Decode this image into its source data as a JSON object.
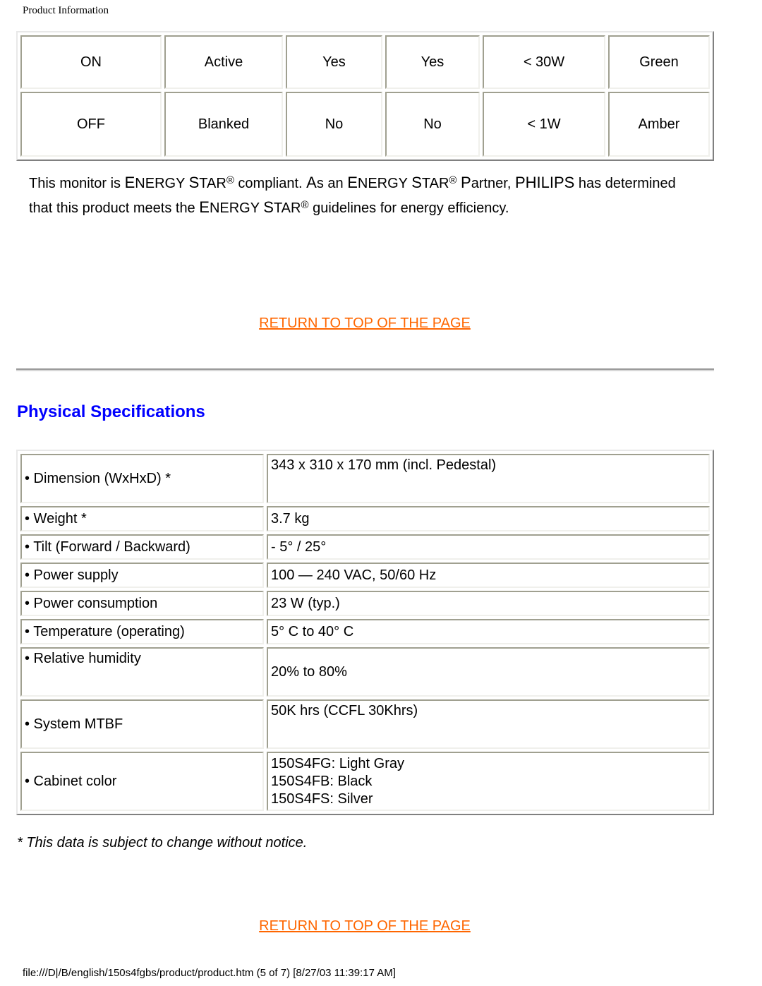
{
  "header": {
    "title": "Product Information"
  },
  "power_table": {
    "rows": [
      [
        "ON",
        "Active",
        "Yes",
        "Yes",
        "< 30W",
        "Green"
      ],
      [
        "OFF",
        "Blanked",
        "No",
        "No",
        "< 1W",
        "Amber"
      ]
    ]
  },
  "energy_star": {
    "p1_a": "This monitor is ",
    "brand_cap_e": "E",
    "brand_rest_1": "NERGY ",
    "brand_cap_s": "S",
    "brand_rest_2": "TAR",
    "reg": "®",
    "p1_b": " compliant. ",
    "as_cap": "A",
    "as_rest": "s an ",
    "p1_c": " ",
    "partner_cap": "P",
    "partner_rest": "artner, ",
    "philips": "PHILIPS",
    "p1_d": " has determined that this product meets the ",
    "p1_e": " guidelines for energy efficiency."
  },
  "links": {
    "return_top": "RETURN TO TOP OF THE PAGE"
  },
  "physical": {
    "title": "Physical Specifications",
    "rows": [
      {
        "label": "• Dimension (WxHxD) *",
        "value": [
          "343 x 310 x 170 mm (incl. Pedestal)"
        ]
      },
      {
        "label": "• Weight *",
        "value": [
          "3.7 kg"
        ]
      },
      {
        "label": "• Tilt (Forward / Backward)",
        "value": [
          "- 5° / 25°"
        ]
      },
      {
        "label": "• Power supply",
        "value": [
          "100 — 240 VAC, 50/60 Hz"
        ]
      },
      {
        "label": "• Power consumption",
        "value": [
          "23 W (typ.)"
        ]
      },
      {
        "label": "• Temperature (operating)",
        "value": [
          "5° C to 40° C"
        ]
      },
      {
        "label": "• Relative humidity",
        "value": [
          "20% to 80%"
        ]
      },
      {
        "label": "• System MTBF",
        "value": [
          "50K hrs (CCFL 30Khrs)"
        ]
      },
      {
        "label": "• Cabinet color",
        "value": [
          "150S4FG: Light Gray",
          "150S4FB: Black",
          "150S4FS: Silver"
        ]
      }
    ],
    "footnote": "* This data is subject to change without notice."
  },
  "footer": {
    "file_path": "file:///D|/B/english/150s4fgbs/product/product.htm (5 of 7) [8/27/03 11:39:17 AM]"
  },
  "colors": {
    "link": "#ff6600",
    "heading": "#0000ff"
  }
}
